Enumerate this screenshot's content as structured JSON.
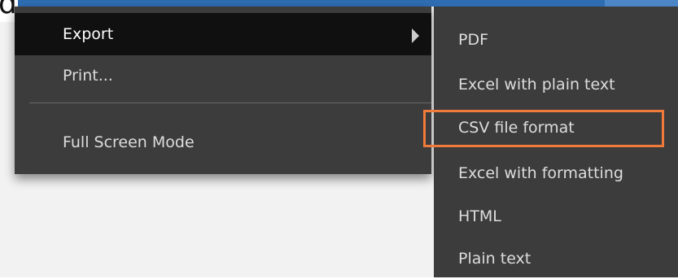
{
  "background_label": "d",
  "menu": {
    "items": [
      {
        "label": "Export",
        "active": true,
        "has_submenu": true
      },
      {
        "label": "Print..."
      },
      {
        "label": "Full Screen Mode"
      }
    ]
  },
  "submenu": {
    "items": [
      {
        "label": "PDF"
      },
      {
        "label": "Excel with plain text"
      },
      {
        "label": "CSV file format",
        "highlighted": true
      },
      {
        "label": "Excel with formatting"
      },
      {
        "label": "HTML"
      },
      {
        "label": "Plain text"
      }
    ]
  },
  "colors": {
    "menu_bg": "#3c3c3c",
    "active_item_bg": "#101010",
    "highlight_border": "#f07a3a",
    "top_bar": "#2f6db3"
  }
}
